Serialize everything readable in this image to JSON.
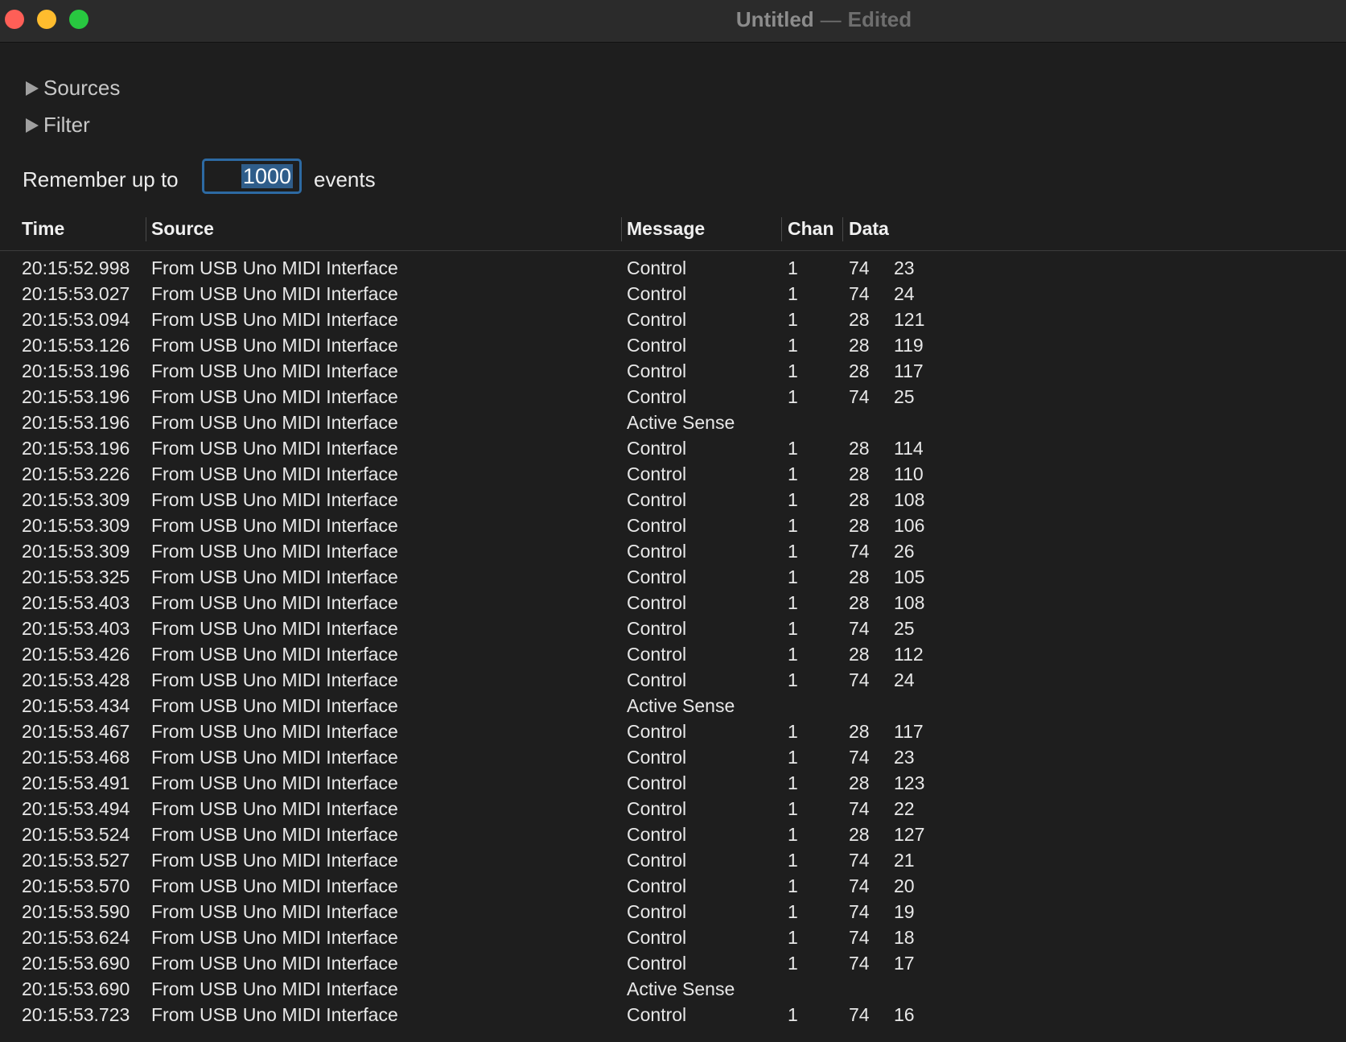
{
  "window": {
    "title": "Untitled",
    "separator": "—",
    "status": "Edited"
  },
  "disclosures": {
    "sources": "Sources",
    "filter": "Filter"
  },
  "remember": {
    "prefix": "Remember up to",
    "value": "1000",
    "suffix": "events"
  },
  "table": {
    "columns": [
      "Time",
      "Source",
      "Message",
      "Chan",
      "Data"
    ],
    "rows": [
      {
        "time": "20:15:52.998",
        "source": "From USB Uno MIDI Interface",
        "message": "Control",
        "chan": "1",
        "d1": "74",
        "d2": "23"
      },
      {
        "time": "20:15:53.027",
        "source": "From USB Uno MIDI Interface",
        "message": "Control",
        "chan": "1",
        "d1": "74",
        "d2": "24"
      },
      {
        "time": "20:15:53.094",
        "source": "From USB Uno MIDI Interface",
        "message": "Control",
        "chan": "1",
        "d1": "28",
        "d2": "121"
      },
      {
        "time": "20:15:53.126",
        "source": "From USB Uno MIDI Interface",
        "message": "Control",
        "chan": "1",
        "d1": "28",
        "d2": "119"
      },
      {
        "time": "20:15:53.196",
        "source": "From USB Uno MIDI Interface",
        "message": "Control",
        "chan": "1",
        "d1": "28",
        "d2": "117"
      },
      {
        "time": "20:15:53.196",
        "source": "From USB Uno MIDI Interface",
        "message": "Control",
        "chan": "1",
        "d1": "74",
        "d2": "25"
      },
      {
        "time": "20:15:53.196",
        "source": "From USB Uno MIDI Interface",
        "message": "Active Sense",
        "chan": "",
        "d1": "",
        "d2": ""
      },
      {
        "time": "20:15:53.196",
        "source": "From USB Uno MIDI Interface",
        "message": "Control",
        "chan": "1",
        "d1": "28",
        "d2": "114"
      },
      {
        "time": "20:15:53.226",
        "source": "From USB Uno MIDI Interface",
        "message": "Control",
        "chan": "1",
        "d1": "28",
        "d2": "110"
      },
      {
        "time": "20:15:53.309",
        "source": "From USB Uno MIDI Interface",
        "message": "Control",
        "chan": "1",
        "d1": "28",
        "d2": "108"
      },
      {
        "time": "20:15:53.309",
        "source": "From USB Uno MIDI Interface",
        "message": "Control",
        "chan": "1",
        "d1": "28",
        "d2": "106"
      },
      {
        "time": "20:15:53.309",
        "source": "From USB Uno MIDI Interface",
        "message": "Control",
        "chan": "1",
        "d1": "74",
        "d2": "26"
      },
      {
        "time": "20:15:53.325",
        "source": "From USB Uno MIDI Interface",
        "message": "Control",
        "chan": "1",
        "d1": "28",
        "d2": "105"
      },
      {
        "time": "20:15:53.403",
        "source": "From USB Uno MIDI Interface",
        "message": "Control",
        "chan": "1",
        "d1": "28",
        "d2": "108"
      },
      {
        "time": "20:15:53.403",
        "source": "From USB Uno MIDI Interface",
        "message": "Control",
        "chan": "1",
        "d1": "74",
        "d2": "25"
      },
      {
        "time": "20:15:53.426",
        "source": "From USB Uno MIDI Interface",
        "message": "Control",
        "chan": "1",
        "d1": "28",
        "d2": "112"
      },
      {
        "time": "20:15:53.428",
        "source": "From USB Uno MIDI Interface",
        "message": "Control",
        "chan": "1",
        "d1": "74",
        "d2": "24"
      },
      {
        "time": "20:15:53.434",
        "source": "From USB Uno MIDI Interface",
        "message": "Active Sense",
        "chan": "",
        "d1": "",
        "d2": ""
      },
      {
        "time": "20:15:53.467",
        "source": "From USB Uno MIDI Interface",
        "message": "Control",
        "chan": "1",
        "d1": "28",
        "d2": "117"
      },
      {
        "time": "20:15:53.468",
        "source": "From USB Uno MIDI Interface",
        "message": "Control",
        "chan": "1",
        "d1": "74",
        "d2": "23"
      },
      {
        "time": "20:15:53.491",
        "source": "From USB Uno MIDI Interface",
        "message": "Control",
        "chan": "1",
        "d1": "28",
        "d2": "123"
      },
      {
        "time": "20:15:53.494",
        "source": "From USB Uno MIDI Interface",
        "message": "Control",
        "chan": "1",
        "d1": "74",
        "d2": "22"
      },
      {
        "time": "20:15:53.524",
        "source": "From USB Uno MIDI Interface",
        "message": "Control",
        "chan": "1",
        "d1": "28",
        "d2": "127"
      },
      {
        "time": "20:15:53.527",
        "source": "From USB Uno MIDI Interface",
        "message": "Control",
        "chan": "1",
        "d1": "74",
        "d2": "21"
      },
      {
        "time": "20:15:53.570",
        "source": "From USB Uno MIDI Interface",
        "message": "Control",
        "chan": "1",
        "d1": "74",
        "d2": "20"
      },
      {
        "time": "20:15:53.590",
        "source": "From USB Uno MIDI Interface",
        "message": "Control",
        "chan": "1",
        "d1": "74",
        "d2": "19"
      },
      {
        "time": "20:15:53.624",
        "source": "From USB Uno MIDI Interface",
        "message": "Control",
        "chan": "1",
        "d1": "74",
        "d2": "18"
      },
      {
        "time": "20:15:53.690",
        "source": "From USB Uno MIDI Interface",
        "message": "Control",
        "chan": "1",
        "d1": "74",
        "d2": "17"
      },
      {
        "time": "20:15:53.690",
        "source": "From USB Uno MIDI Interface",
        "message": "Active Sense",
        "chan": "",
        "d1": "",
        "d2": ""
      },
      {
        "time": "20:15:53.723",
        "source": "From USB Uno MIDI Interface",
        "message": "Control",
        "chan": "1",
        "d1": "74",
        "d2": "16"
      }
    ]
  },
  "colors": {
    "background": "#1e1e1e",
    "titlebar": "#2b2b2b",
    "close": "#fe5f57",
    "minimize": "#febc2e",
    "maximize": "#28c840",
    "focus_ring": "#2d6aa3"
  }
}
